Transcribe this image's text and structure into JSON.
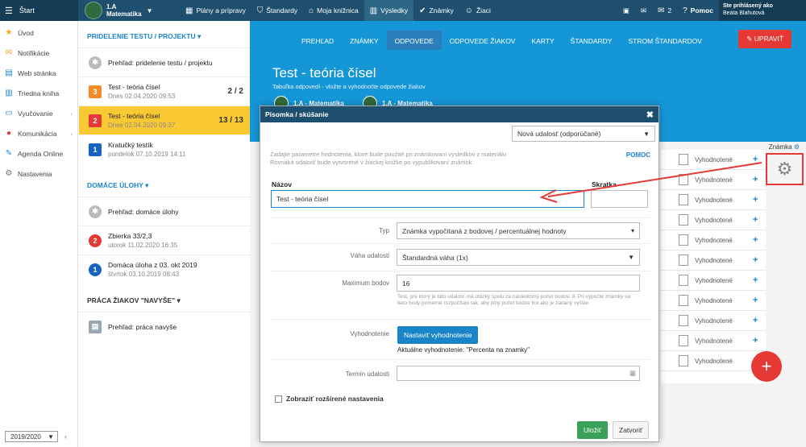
{
  "topbar": {
    "start": "Štart",
    "class_line1": "1.A",
    "class_line2": "Matematika",
    "nav": [
      {
        "label": "Plány a prípravy",
        "icon": "calendar-icon"
      },
      {
        "label": "Štandardy",
        "icon": "shield-icon"
      },
      {
        "label": "Moja knižnica",
        "icon": "library-icon"
      },
      {
        "label": "Výsledky",
        "icon": "chart-icon"
      },
      {
        "label": "Známky",
        "icon": "check-icon"
      },
      {
        "label": "Žiaci",
        "icon": "students-icon"
      }
    ],
    "msg_count": "2",
    "help": "Pomoc",
    "user_line1": "Ste prihlásený ako",
    "user_line2": "Beáta Blahutová"
  },
  "sidebar": {
    "items": [
      {
        "label": "Úvod",
        "icon": "star-icon",
        "color": "#f5a623"
      },
      {
        "label": "Notifikácie",
        "icon": "mail-icon",
        "color": "#f5a623"
      },
      {
        "label": "Web stránka",
        "icon": "web-icon",
        "color": "#1a84c9"
      },
      {
        "label": "Triedna kniha",
        "icon": "book-icon",
        "color": "#1a84c9"
      },
      {
        "label": "Vyučovanie",
        "icon": "board-icon",
        "color": "#1a84c9"
      },
      {
        "label": "Komunikácia",
        "icon": "chat-icon",
        "color": "#e53935"
      },
      {
        "label": "Agenda Online",
        "icon": "agenda-icon",
        "color": "#1a84c9"
      },
      {
        "label": "Nastavenia",
        "icon": "gear-icon",
        "color": "#777"
      }
    ],
    "year": "2019/2020"
  },
  "middle": {
    "section1": "PRIDELENIE TESTU / PROJEKTU",
    "section1_rows": [
      {
        "title": "Prehľad: pridelenie testu / projektu",
        "sub": "",
        "badge": "",
        "badge_color": "#bbb",
        "count": ""
      },
      {
        "title": "Test - teória čísel",
        "sub": "Dnes 02.04.2020 09:53",
        "badge": "3",
        "badge_color": "#f28c28",
        "count": "2 / 2"
      },
      {
        "title": "Test - teória čísel",
        "sub": "Dnes 02.04.2020 09:37",
        "badge": "2",
        "badge_color": "#e53935",
        "count": "13 / 13"
      },
      {
        "title": "Kratučký testík",
        "sub": "pondelok 07.10.2019 14:11",
        "badge": "1",
        "badge_color": "#1565c0",
        "count": ""
      }
    ],
    "section2": "DOMÁCE ÚLOHY",
    "section2_rows": [
      {
        "title": "Prehľad: domáce úlohy",
        "sub": "",
        "badge": "",
        "badge_color": "#bbb"
      },
      {
        "title": "Zbierka 33/2,3",
        "sub": "utorok 11.02.2020 16:35",
        "badge": "2",
        "badge_color": "#e53935"
      },
      {
        "title": "Domáca úloha z 03. okt 2019",
        "sub": "štvrtok 03.10.2019 08:43",
        "badge": "1",
        "badge_color": "#1565c0"
      }
    ],
    "section3": "PRÁCA ŽIAKOV \"NAVYŠE\"",
    "section3_rows": [
      {
        "title": "Prehľad: práca navyše"
      }
    ]
  },
  "main": {
    "tabs": [
      "PREHĽAD",
      "ZNÁMKY",
      "ODPOVEDE",
      "ODPOVEDE ŽIAKOV",
      "KARTY",
      "ŠTANDARDY",
      "STROM ŠTANDARDOV"
    ],
    "active_tab": 2,
    "edit_button": "UPRAVIŤ",
    "title": "Test - teória čísel",
    "subtitle": "Tabuľka odpovedí - vložte a vyhodnoťte odpovede žiakov",
    "chips": [
      "1.A - Matematika",
      "1.A - Matematika"
    ],
    "grade_label": "Známka",
    "grid_rows": [
      "Vyhodnotené",
      "Vyhodnotené",
      "Vyhodnotené",
      "Vyhodnotené",
      "Vyhodnotené",
      "Vyhodnotené",
      "Vyhodnotené",
      "Vyhodnotené",
      "Vyhodnotené",
      "Vyhodnotené",
      "Vyhodnotené"
    ]
  },
  "modal": {
    "title": "Písomka / skúšanie",
    "event_select": "Nová udalosť (odporúčané)",
    "hint_line1": "Zadajte parametre hodnotenia, ktoré bude použité pri známkovaní výsledkov z materiálu",
    "hint_line2": "Rovnaká udalosť bude vytvorené v žiackej knižke po vypublikovaní známok",
    "help": "POMOC",
    "name_label": "Názov",
    "name_value": "Test - teória čísel",
    "short_label": "Skratka",
    "short_value": "",
    "type_label": "Typ",
    "type_value": "Známka vypočítaná z bodovej / percentuálnej hodnoty",
    "weight_label": "Váha udalosti",
    "weight_value": "Štandardná váha (1x)",
    "max_label": "Maximum bodov",
    "max_value": "16",
    "max_hint": "Test, pre ktorý je táto udalosť má otázky spolu za nasledovný počet bodov: 8. Pri výpočte známky sa tieto body pomerne rozpočítajú tak, aby plný počet bodov bol ako je zadaný vyššie.",
    "eval_label": "Vyhodnotenie",
    "eval_button": "Nastaviť vyhodnotenie",
    "eval_current": "Aktuálne vyhodnotenie: \"Percenta na znamky\"",
    "term_label": "Termín udalosti",
    "term_value": "",
    "advanced": "Zobraziť rozšírené nastavenia",
    "save": "Uložiť",
    "close": "Zatvoriť"
  }
}
